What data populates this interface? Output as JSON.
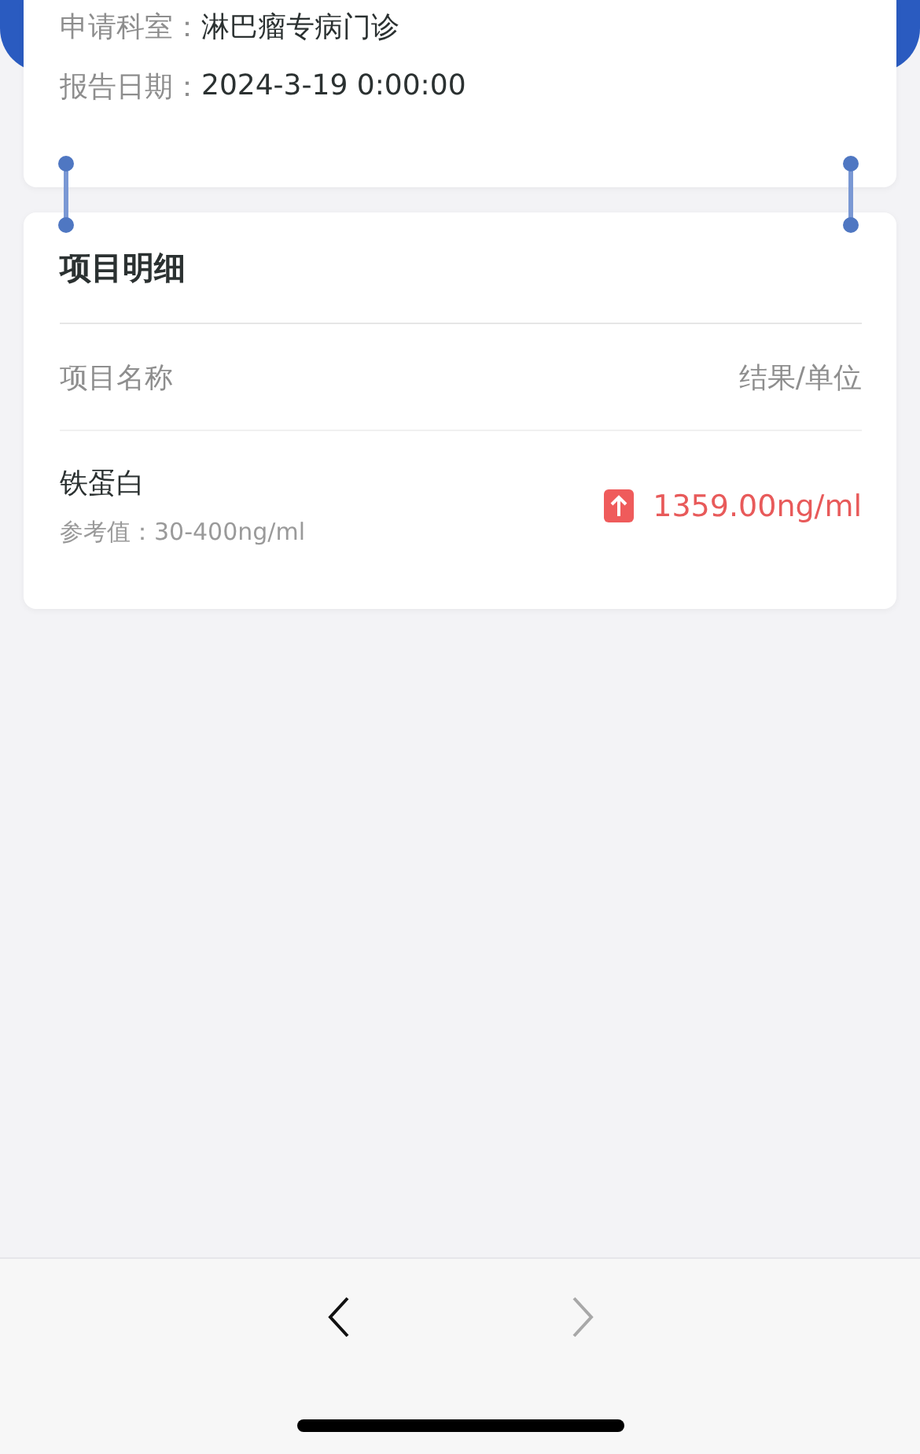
{
  "report_info": [
    {
      "label": "申请科室：",
      "value": "淋巴瘤专病门诊"
    },
    {
      "label": "报告日期：",
      "value": "2024-3-19 0:00:00"
    }
  ],
  "details": {
    "title": "项目明细",
    "columns": [
      "项目名称",
      "结果/单位"
    ],
    "items": [
      {
        "name": "铁蛋白",
        "reference": "参考值：30-400ng/ml",
        "result": "1359.00ng/ml",
        "high": true
      }
    ]
  },
  "browser_nav": {
    "back": {
      "disabled": false
    },
    "forward": {
      "disabled": true
    }
  }
}
